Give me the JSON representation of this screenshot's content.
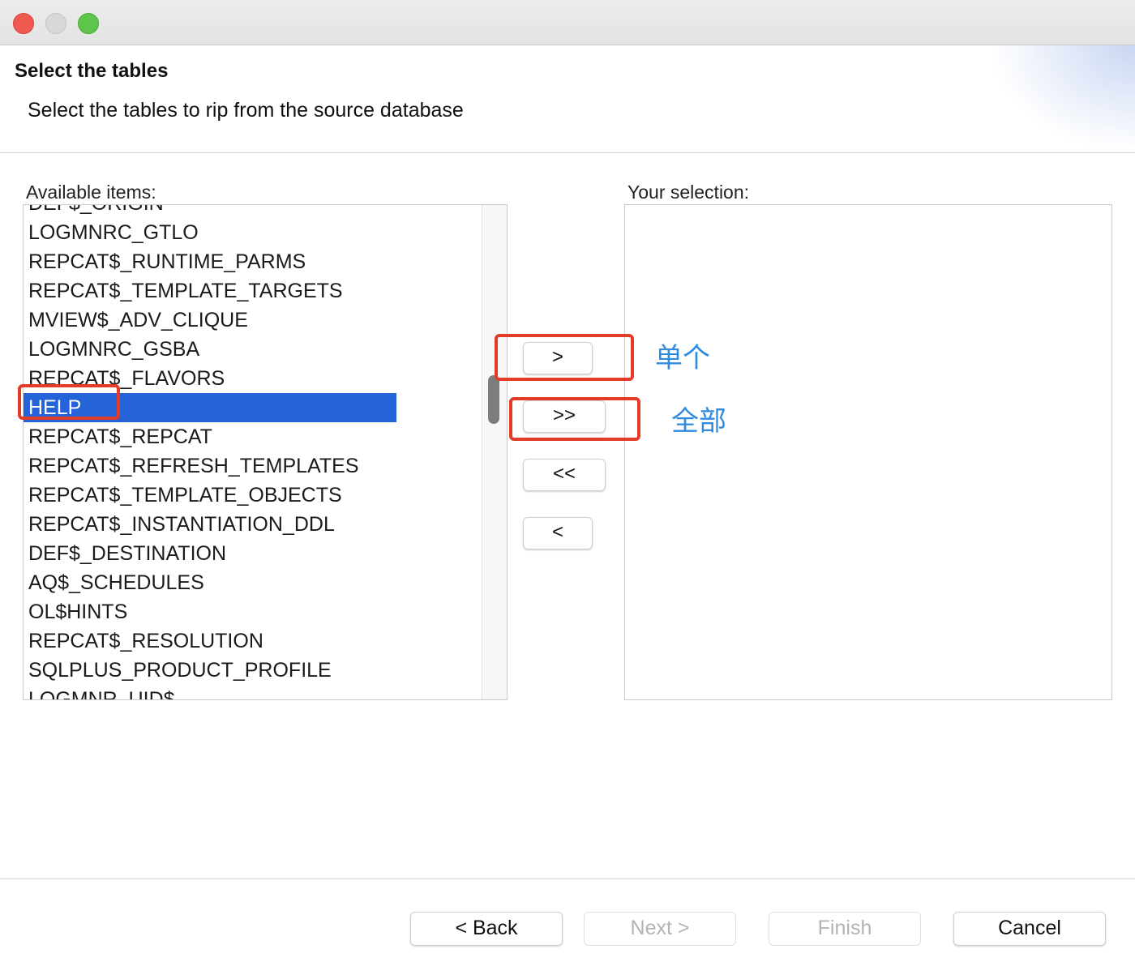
{
  "window": {
    "controls": [
      "close-button",
      "minimize-button",
      "maximize-button"
    ]
  },
  "header": {
    "title": "Select the tables",
    "description": "Select the tables to rip from the source database"
  },
  "available": {
    "label": "Available items:",
    "items": [
      {
        "label": "DEF$_ORIGIN",
        "selected": false
      },
      {
        "label": "LOGMNRC_GTLO",
        "selected": false
      },
      {
        "label": "REPCAT$_RUNTIME_PARMS",
        "selected": false
      },
      {
        "label": "REPCAT$_TEMPLATE_TARGETS",
        "selected": false
      },
      {
        "label": "MVIEW$_ADV_CLIQUE",
        "selected": false
      },
      {
        "label": "LOGMNRC_GSBA",
        "selected": false
      },
      {
        "label": "REPCAT$_FLAVORS",
        "selected": false
      },
      {
        "label": "HELP",
        "selected": true
      },
      {
        "label": "REPCAT$_REPCAT",
        "selected": false
      },
      {
        "label": "REPCAT$_REFRESH_TEMPLATES",
        "selected": false
      },
      {
        "label": "REPCAT$_TEMPLATE_OBJECTS",
        "selected": false
      },
      {
        "label": "REPCAT$_INSTANTIATION_DDL",
        "selected": false
      },
      {
        "label": "DEF$_DESTINATION",
        "selected": false
      },
      {
        "label": "AQ$_SCHEDULES",
        "selected": false
      },
      {
        "label": "OL$HINTS",
        "selected": false
      },
      {
        "label": "REPCAT$_RESOLUTION",
        "selected": false
      },
      {
        "label": "SQLPLUS_PRODUCT_PROFILE",
        "selected": false
      },
      {
        "label": "LOGMNR_UID$",
        "selected": false
      }
    ]
  },
  "selection": {
    "label": "Your selection:",
    "items": []
  },
  "transfer": {
    "add": ">",
    "add_all": ">>",
    "remove_all": "<<",
    "remove": "<"
  },
  "annotations": {
    "single": "单个",
    "all": "全部",
    "color": "#e23b27",
    "text_color": "#2f8be0"
  },
  "footer": {
    "back": "< Back",
    "next": "Next >",
    "finish": "Finish",
    "cancel": "Cancel",
    "next_enabled": false,
    "finish_enabled": false
  },
  "colors": {
    "selection_bg": "#2563d9",
    "close": "#ee5a52",
    "maximize": "#5ec44b"
  }
}
